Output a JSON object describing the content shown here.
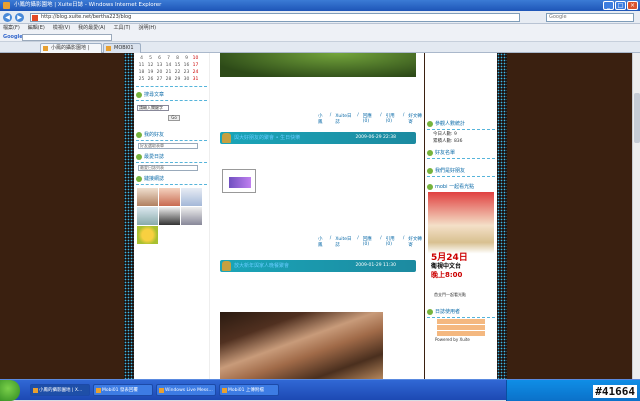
{
  "window": {
    "title": "小鳳的攝影園地 | Xuite日誌 - Windows Internet Explorer"
  },
  "nav": {
    "url": "http://blog.xuite.net/bertha223/blog",
    "search_placeholder": "Google"
  },
  "menu": [
    "檔案(F)",
    "編輯(E)",
    "檢視(V)",
    "我的最愛(A)",
    "工具(T)",
    "說明(H)"
  ],
  "google": {
    "logo": "Google"
  },
  "tabs": [
    {
      "label": "小鳳的攝影園地 | Xuit..."
    },
    {
      "label": "MOBI01"
    }
  ],
  "calendar": {
    "rows": [
      [
        "4",
        "5",
        "6",
        "7",
        "8",
        "9",
        "10"
      ],
      [
        "11",
        "12",
        "13",
        "14",
        "15",
        "16",
        "17"
      ],
      [
        "18",
        "19",
        "20",
        "21",
        "22",
        "23",
        "24"
      ],
      [
        "25",
        "26",
        "27",
        "28",
        "29",
        "30",
        "31"
      ]
    ]
  },
  "left": {
    "search_heading": "搜尋文章",
    "search_placeholder": "請輸入關鍵字",
    "go_label": "Go",
    "friends_heading": "我的好友",
    "friends_select": "好友選取表單",
    "fav_heading": "最愛日誌",
    "fav_select": "最愛日誌列表",
    "links_heading": "鏈接網誌"
  },
  "posts": [
    {
      "title": "與大好朋友的聚會 • 生日快樂",
      "date": "2009-06-29 22:38"
    },
    {
      "title": "放大新年與家人晚餐聚會",
      "date": "2009-01-29 11:30"
    }
  ],
  "post_footer": [
    "小鳳",
    "Xuite日誌",
    "回應(0)",
    "引用(0)",
    "好文轉寄"
  ],
  "right": {
    "stats_heading": "參觀人數統計",
    "today": "今日人數: 9",
    "total": "累積人數: 836",
    "friends_heading": "好友名單",
    "we_heading": "我們是好朋友",
    "ad_heading": "mobi 一起看光點",
    "ad_date": "5月24日",
    "ad_channel": "衛視中文台",
    "ad_time": "晚上8:00",
    "ad_sub": "首支門一起看光點",
    "users_heading": "日誌使用者",
    "powered": "Powered by Xuite"
  },
  "taskbar": [
    "小鳳的攝影園地 | X...",
    "Mobi01 發表回覆",
    "Windows Live Mess...",
    "Mobi01 上傳附檔"
  ],
  "watermark": "#41664"
}
